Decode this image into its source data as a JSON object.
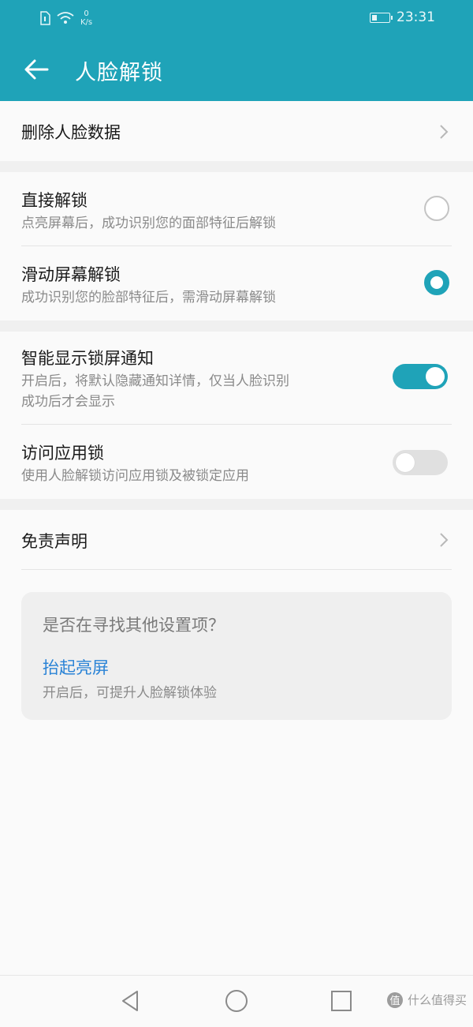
{
  "statusbar": {
    "net_speed_value": "0",
    "net_speed_unit": "K/s",
    "time": "23:31",
    "icons": [
      "sim-icon",
      "wifi-icon",
      "battery-icon"
    ]
  },
  "appbar": {
    "title": "人脸解锁",
    "back_icon": "arrow-left-icon"
  },
  "delete_face_data": {
    "label": "删除人脸数据"
  },
  "unlock_modes": [
    {
      "title": "直接解锁",
      "subtitle": "点亮屏幕后，成功识别您的面部特征后解锁",
      "selected": false
    },
    {
      "title": "滑动屏幕解锁",
      "subtitle": "成功识别您的脸部特征后，需滑动屏幕解锁",
      "selected": true
    }
  ],
  "toggles": [
    {
      "title": "智能显示锁屏通知",
      "subtitle_line1": "开启后，将默认隐藏通知详情，仅当人脸识别",
      "subtitle_line2": "成功后才会显示",
      "on": true
    },
    {
      "title": "访问应用锁",
      "subtitle_line1": "使用人脸解锁访问应用锁及被锁定应用",
      "on": false
    }
  ],
  "disclaimer": {
    "label": "免责声明"
  },
  "suggestion_card": {
    "question": "是否在寻找其他设置项？",
    "link": "抬起亮屏",
    "description": "开启后，可提升人脸解锁体验"
  },
  "watermark": {
    "badge": "值",
    "text": "什么值得买"
  },
  "colors": {
    "accent": "#1fa3b8",
    "link": "#2a83d6"
  }
}
